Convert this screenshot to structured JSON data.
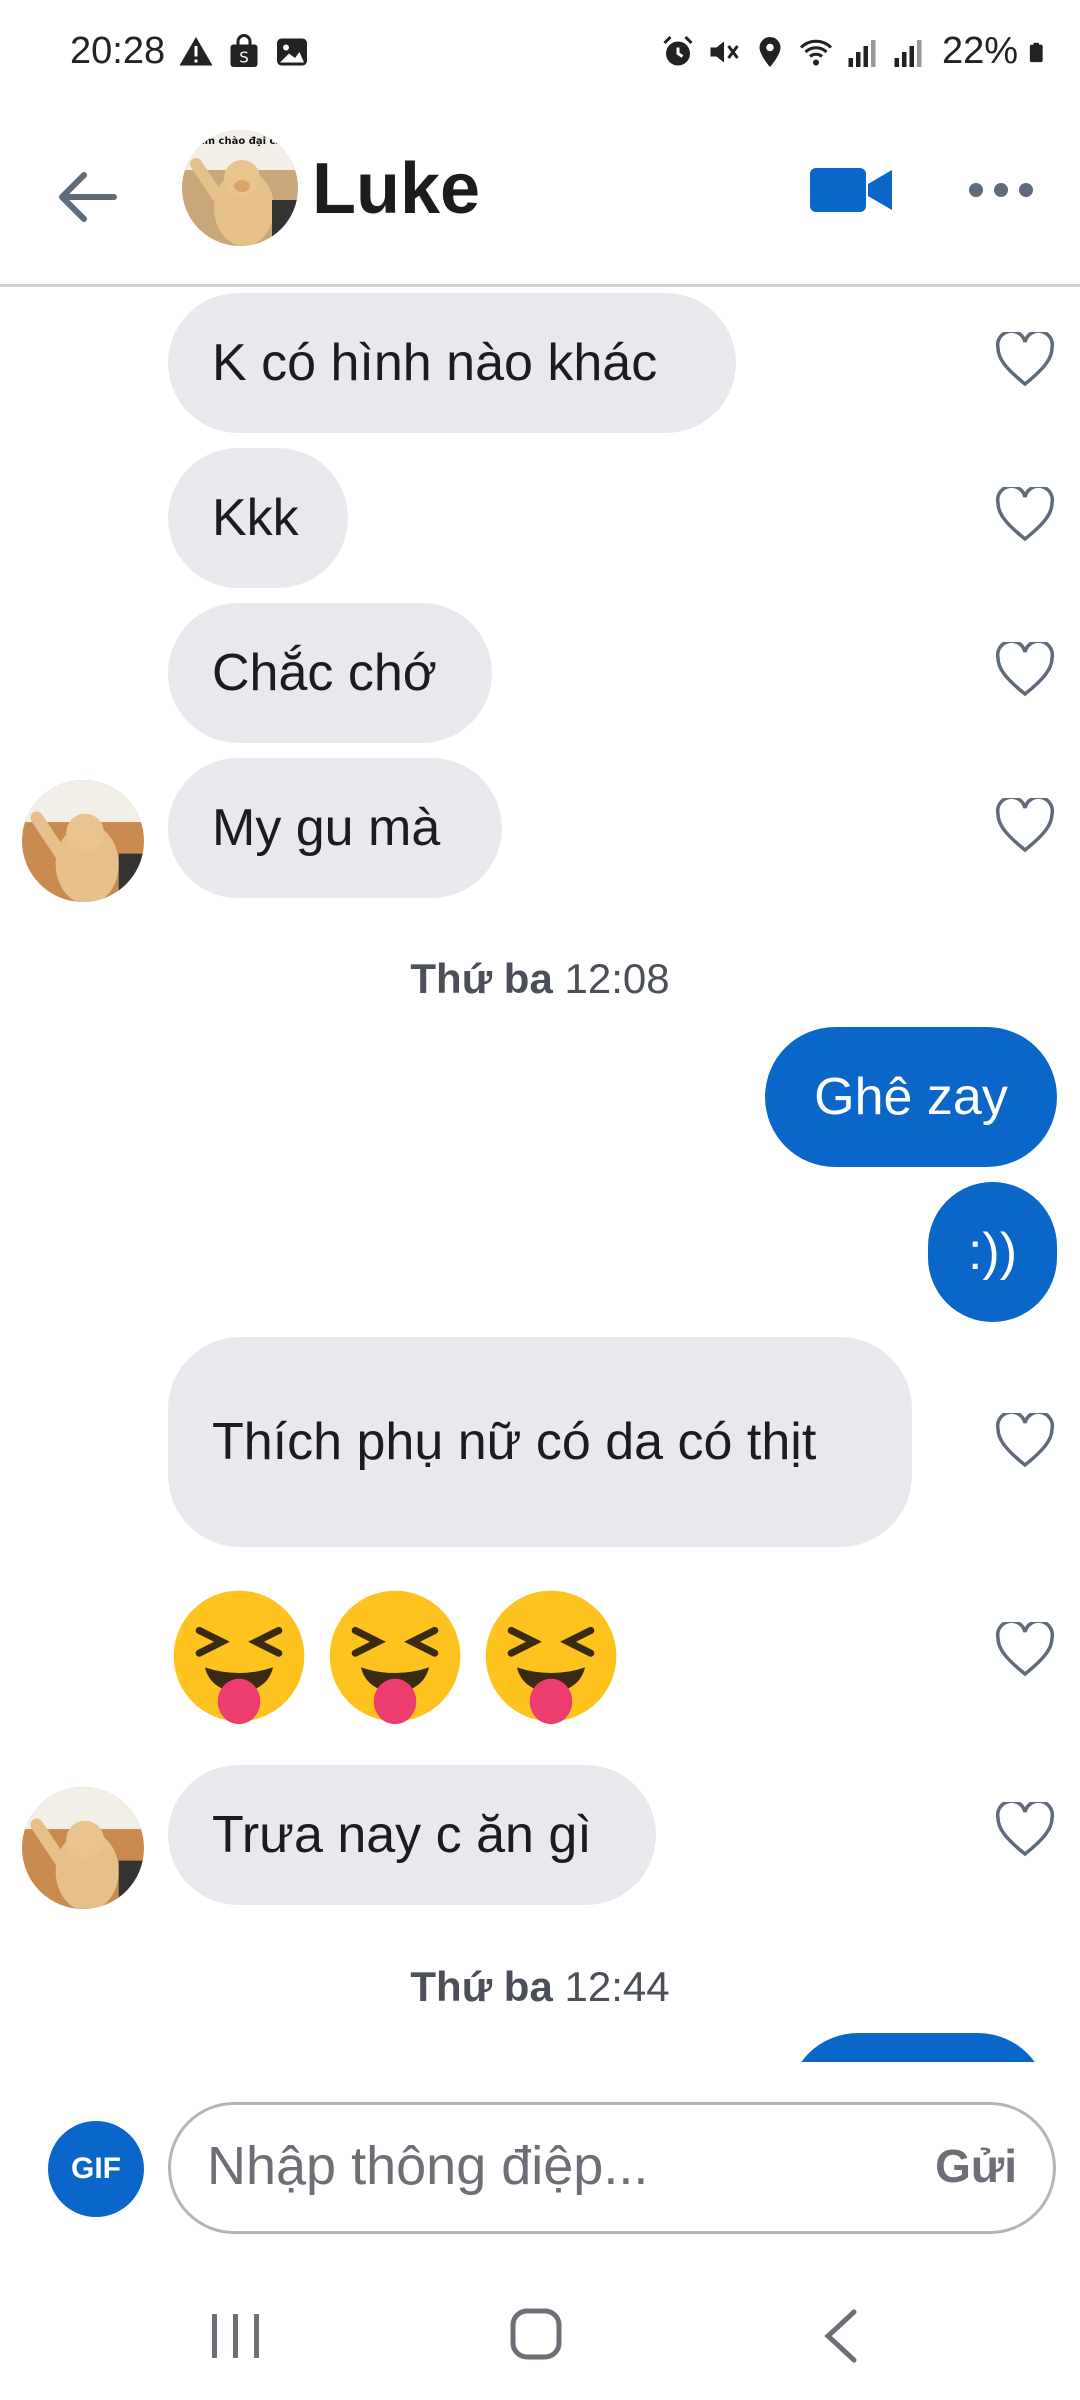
{
  "status_bar": {
    "time": "20:28",
    "battery": "22%",
    "left_icons": [
      "warning-icon",
      "shopping-bag-icon",
      "image-icon"
    ],
    "right_icons": [
      "alarm-icon",
      "mute-icon",
      "location-icon",
      "wifi-icon",
      "signal-icon",
      "signal-icon",
      "battery-icon"
    ]
  },
  "header": {
    "contact_name": "Luke",
    "avatar_caption": "Em chào đại ca"
  },
  "messages": {
    "m1": "K có hình nào khác",
    "m2": "Kkk",
    "m3": "Chắc chớ",
    "m4": "My gu mà",
    "ts1_day": "Thứ ba",
    "ts1_time": "12:08",
    "o1": "Ghê zay",
    "o2": ":))",
    "m5": "Thích phụ nữ có da có thịt",
    "emojis": [
      "😝",
      "😝",
      "😝"
    ],
    "m6": "Trưa nay c ăn gì",
    "ts2_day": "Thứ ba",
    "ts2_time": "12:44"
  },
  "composer": {
    "gif_label": "GIF",
    "placeholder": "Nhập thông điệp...",
    "send_label": "Gửi"
  },
  "colors": {
    "accent": "#0a67c9",
    "incoming_bubble": "#e9e9ed",
    "muted_text": "#6c6f76"
  }
}
